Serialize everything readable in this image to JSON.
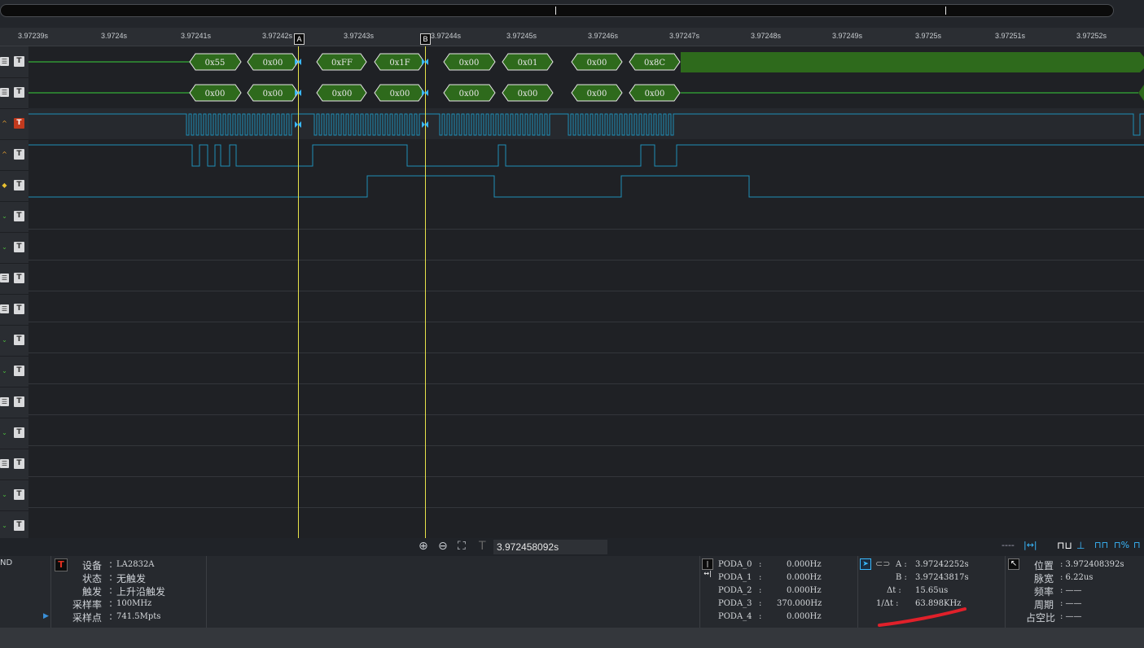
{
  "ruler": {
    "ticks": [
      "3.97239s",
      "3.9724s",
      "3.97241s",
      "3.97242s",
      "3.97243s",
      "3.97244s",
      "3.97245s",
      "3.97246s",
      "3.97247s",
      "3.97248s",
      "3.97249s",
      "3.9725s",
      "3.97251s",
      "3.97252s"
    ],
    "cursor_a": "A",
    "cursor_b": "B"
  },
  "decoders": {
    "row1": [
      "0x55",
      "0x00",
      "0xFF",
      "0x1F",
      "0x00",
      "0x01",
      "0x00",
      "0x8C"
    ],
    "row2": [
      "0x00",
      "0x00",
      "0x00",
      "0x00",
      "0x00",
      "0x00",
      "0x00",
      "0x00"
    ]
  },
  "zoom": {
    "time_value": "3.972458092s"
  },
  "device_panel": {
    "left_label": "ND",
    "device_label": "设备",
    "device_value": "LA2832A",
    "status_label": "状态",
    "status_value": "无触发",
    "trigger_label": "触发",
    "trigger_value": "上升沿触发",
    "rate_label": "采样率",
    "rate_value": "100MHz",
    "points_label": "采样点",
    "points_value": "741.5Mpts"
  },
  "freq_panel": {
    "rows": [
      {
        "name": "PODA_0",
        "sep": ":",
        "value": "0.000Hz"
      },
      {
        "name": "PODA_1",
        "sep": ":",
        "value": "0.000Hz"
      },
      {
        "name": "PODA_2",
        "sep": ":",
        "value": "0.000Hz"
      },
      {
        "name": "PODA_3",
        "sep": ":",
        "value": "370.000Hz"
      },
      {
        "name": "PODA_4",
        "sep": ":",
        "value": "0.000Hz"
      }
    ]
  },
  "cursor_panel": {
    "a_label": "A :",
    "a_value": "3.97242252s",
    "b_label": "B :",
    "b_value": "3.97243817s",
    "dt_label": "Δt :",
    "dt_value": "15.65us",
    "inv_label": "1/Δt :",
    "inv_value": "63.898KHz"
  },
  "measure_panel": {
    "pos_label": "位置",
    "pos_value": ": 3.972408392s",
    "width_label": "脉宽",
    "width_value": ": 6.22us",
    "freq_label": "频率",
    "freq_value": ": ——",
    "period_label": "周期",
    "period_value": ": ——",
    "duty_label": "占空比",
    "duty_value": ": ——"
  },
  "colors": {
    "decode_fill": "#2e6a1c",
    "signal_blue": "#1f8fb8",
    "cursor_yellow": "#e8e24a",
    "annotation_red": "#e0202a"
  }
}
